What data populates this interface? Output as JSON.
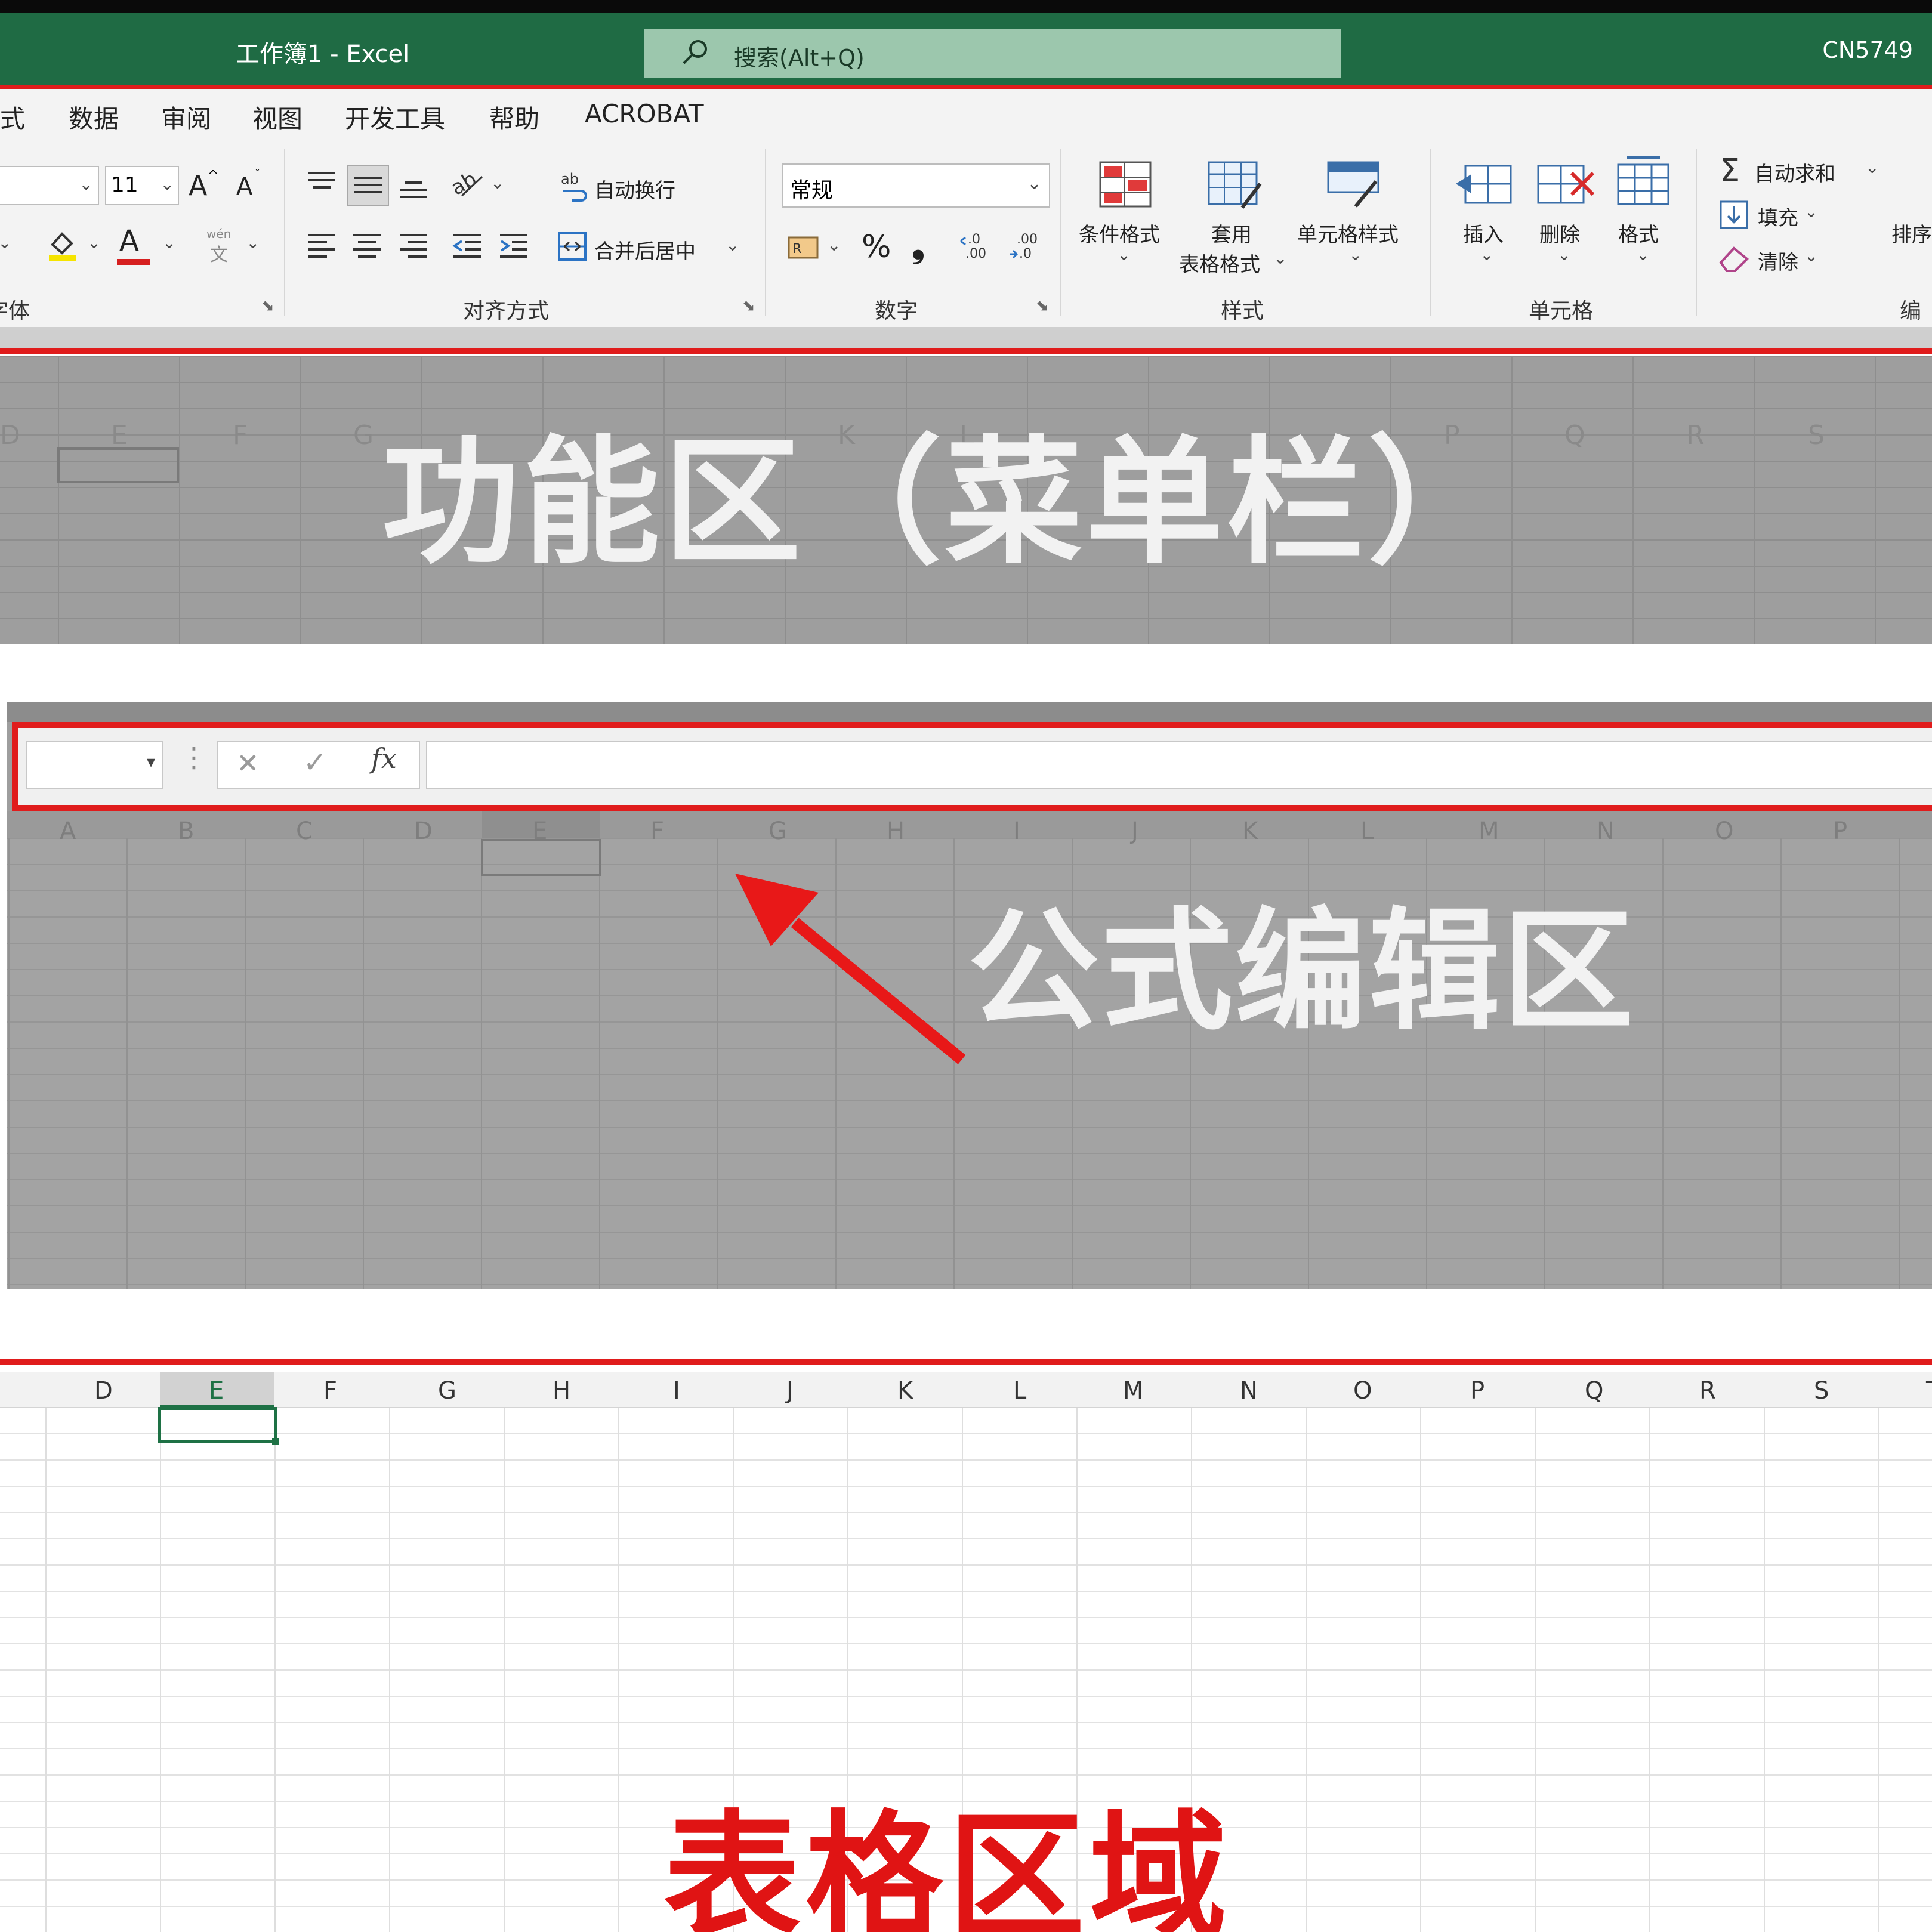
{
  "window": {
    "title": "工作簿1 - Excel",
    "search_placeholder": "搜索(Alt+Q)",
    "user": "CN5749"
  },
  "tabs": [
    "式",
    "数据",
    "审阅",
    "视图",
    "开发工具",
    "帮助",
    "ACROBAT"
  ],
  "ribbon": {
    "font_size": "11",
    "font_grow": "A",
    "font_shrink": "A",
    "font_color_letter": "A",
    "phonetic": "wén",
    "phonetic_char": "文",
    "wrap_text": "自动换行",
    "merge_center": "合并后居中",
    "number_format": "常规",
    "percent": "%",
    "comma": "❟",
    "cond_format": "条件格式",
    "table_format_1": "套用",
    "table_format_2": "表格格式",
    "cell_styles": "单元格样式",
    "insert": "插入",
    "delete": "删除",
    "format": "格式",
    "autosum": "自动求和",
    "fill": "填充",
    "clear": "清除",
    "sort": "排序",
    "groups": {
      "font": "字体",
      "alignment": "对齐方式",
      "number": "数字",
      "styles": "样式",
      "cells": "单元格",
      "editing": "编辑"
    }
  },
  "labels": {
    "ribbon_area": "功能区（菜单栏）",
    "formula_area": "公式编辑区",
    "grid_area": "表格区域"
  },
  "panel1_faint_cols": [
    "D",
    "E",
    "F",
    "G",
    "K",
    "L",
    "P",
    "Q",
    "R",
    "S"
  ],
  "panel2_cols": [
    "A",
    "B",
    "C",
    "D",
    "E",
    "F",
    "G",
    "H",
    "I",
    "J",
    "K",
    "L",
    "M",
    "N",
    "O",
    "P"
  ],
  "panel3_cols": [
    "D",
    "E",
    "F",
    "G",
    "H",
    "I",
    "J",
    "K",
    "L",
    "M",
    "N",
    "O",
    "P",
    "Q",
    "R",
    "S",
    "T"
  ],
  "formula_bar": {
    "cancel": "✕",
    "enter": "✓",
    "fx": "fx",
    "dots": "⋮"
  },
  "colors": {
    "excel_green": "#1f6b44",
    "highlight_red": "#e01c1c",
    "overlay_gray": "#9e9e9e"
  }
}
